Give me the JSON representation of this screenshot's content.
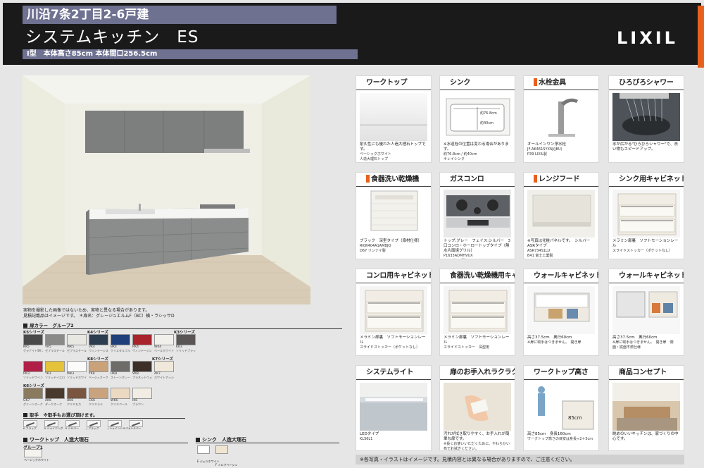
{
  "header": {
    "title": "川沿7条2丁目2-6戸建",
    "product": "システムキッチン　ES",
    "sub": "I型　本体高さ85cm 本体間口256.5cm",
    "logo": "LIXIL"
  },
  "disclaimer": {
    "line1": "実物を撮影した画像ではないため、実物と異なる場合があります。",
    "line2": "見積記載品はイメージです。 ＊扉名：グレージュエルムF（BC）横・ラシッサD"
  },
  "door_color": {
    "title": "扉カラー　グループ2",
    "series": {
      "k5": "K5シリーズ",
      "k4": "K4シリーズ",
      "k3": "K3シリーズ",
      "k8": "K8シリーズ",
      "k7": "K7シリーズ",
      "k6": "K6シリーズ"
    },
    "swatches": [
      {
        "code": "KK5",
        "name": "グラナイトSRブラック",
        "color": "#4a4a4a"
      },
      {
        "code": "VK5",
        "name": "ゼブラスチールシルバー",
        "color": "#8a8a88"
      },
      {
        "code": "WK5",
        "name": "ゼブラスチールホワイト",
        "color": "#e9e7e2"
      },
      {
        "code": "VK4",
        "name": "ヴィンテージストーン",
        "color": "#2b3d4f"
      },
      {
        "code": "BK4",
        "name": "クリスタルブルー",
        "color": "#1f3f7a"
      },
      {
        "code": "RK4",
        "name": "ヴィンテージレッド",
        "color": "#a8232a"
      },
      {
        "code": "WK4",
        "name": "ベールホワイト",
        "color": "#f2f0ea"
      },
      {
        "code": "KK3",
        "name": "ソリッドブラック",
        "color": "#5a5656"
      },
      {
        "code": "RK3",
        "name": "ソリッドワイン",
        "color": "#b21f46"
      },
      {
        "code": "YK3",
        "name": "ソリッドイエロー",
        "color": "#e4c23a"
      },
      {
        "code": "WK3",
        "name": "ソリッドホワイト",
        "color": "#fbfbfa"
      },
      {
        "code": "YK8",
        "name": "ベージュオーク",
        "color": "#c9a27a"
      },
      {
        "code": "UK8",
        "name": "ストーングレー",
        "color": "#6d6c68"
      },
      {
        "code": "VK8",
        "name": "プラネットウォルナット",
        "color": "#3c2f28"
      },
      {
        "code": "AK7",
        "name": "ホワイトアッシュ",
        "color": "#efe8db"
      },
      {
        "code": "GK7",
        "name": "グリーンオーク",
        "color": "#8a7a5e"
      },
      {
        "code": "AK6",
        "name": "ダークオーク",
        "color": "#4a3a2e"
      },
      {
        "code": "UK6",
        "name": "クリエモカ",
        "color": "#7a5540"
      },
      {
        "code": "CK6",
        "name": "クリエラテ",
        "color": "#c9a37d"
      },
      {
        "code": "WK6",
        "name": "クリエペール",
        "color": "#ecd9c1"
      },
      {
        "code": "IK6",
        "name": "ブラウン",
        "color": "#f1ece4"
      }
    ]
  },
  "handles": {
    "title": "取手　※取手もお選び頂けます。",
    "items": [
      "K ブラック",
      "K シャイニング",
      "K シルバー",
      "J ブラック",
      "J シャインシルバー",
      "J シルバー"
    ]
  },
  "worktop": {
    "title": "ワークトップ　人造大理石",
    "group": "グループ1",
    "chip_name": "ベーシックホワイト"
  },
  "sink": {
    "title": "シンク　人造大理石",
    "options": [
      {
        "label": "E",
        "name": "ジェルホワイト",
        "color": "#ffffff"
      },
      {
        "label": "F",
        "name": "ミルクベージュ",
        "color": "#efe5d1"
      }
    ]
  },
  "cards": [
    {
      "title": "ワークトップ",
      "marker": false,
      "desc": "耐久性にも優れた人造大理石トップです。",
      "meta": "ベーシックホワイト",
      "code": "人造大理石トップ"
    },
    {
      "title": "シンク",
      "marker": false,
      "desc": "※水道栓の位置は変わる場合があります。",
      "meta": "約76.8cm / 約40cm",
      "code": "キレイシンク"
    },
    {
      "title": "水栓金具",
      "marker": true,
      "desc": "オールインワン浄水栓",
      "meta": "JF-AK461SYXNJ(JBU)",
      "code": "P39 LIXIL製"
    },
    {
      "title": "ひろびろシャワー",
      "marker": false,
      "desc": "水が広がる\"ひろびろシャワー\"で、洗い物もスピードアップ。",
      "meta": "",
      "code": ""
    },
    {
      "title": "食器洗い乾燥機",
      "marker": true,
      "desc": "ブラック　深型タイプ（扉材仕様）",
      "meta": "RKW404A1AMBJQ",
      "code": "D67 リンナイ製"
    },
    {
      "title": "ガスコンロ",
      "marker": false,
      "desc": "トップ:グレー　フェイス:シルバー　3口コンロ・ホーロートップタイプ（無水片面焼グリル）",
      "meta": "P1633ADMHVUX",
      "code": "Y11 パロマ製"
    },
    {
      "title": "レンジフード",
      "marker": true,
      "desc": "※写真は化粧パネルです。　シルバー　ASRタイプ",
      "meta": "ASR734S1LU",
      "code": "B41 富士工業製"
    },
    {
      "title": "シンク用キャビネット",
      "marker": false,
      "desc": "メラミン扉裏　ソフトモーションレール",
      "meta": "スライドストッカー（ポケットなし）",
      "code": ""
    },
    {
      "title": "コンロ用キャビネット",
      "marker": false,
      "desc": "メラミン扉裏　ソフトモーションレール",
      "meta": "スライドストッカー（ポケットなし）",
      "code": ""
    },
    {
      "title": "食器洗い乾燥機用キャビネット",
      "marker": false,
      "desc": "メラミン扉裏　ソフトモーションレール",
      "meta": "スライドストッカー　深型用",
      "code": ""
    },
    {
      "title": "ウォールキャビネット",
      "marker": false,
      "desc": "高さ37.5cm　奥行60cm",
      "meta": "※扉に取手はつきません。　開き扉",
      "code": ""
    },
    {
      "title": "ウォールキャビネット",
      "marker": false,
      "desc": "高さ37.5cm　奥行60cm",
      "meta": "※扉に取手はつきません。　開き扉　側面・底面不燃仕様",
      "code": ""
    },
    {
      "title": "システムライト",
      "marker": false,
      "desc": "LEDタイプ",
      "meta": "KLS6L1",
      "code": ""
    },
    {
      "title": "扉のお手入れラクラク",
      "marker": false,
      "desc": "汚れが拭き取りやすく、お手入れが簡単な扉です。",
      "meta": "※長くお使いいただくために、やわらかい布でお拭きください。",
      "code": ""
    },
    {
      "title": "ワークトップ高さ",
      "marker": false,
      "desc": "高さ85cm　身長160cm",
      "meta": "ワークトップ高さの目安は身長÷2＋5cm",
      "code": ""
    },
    {
      "title": "商品コンセプト",
      "marker": false,
      "desc": "眺めのいいキッチンは、家づくりの中心です。",
      "meta": "",
      "code": ""
    }
  ],
  "footer": {
    "note": "※各写真・イラストはイメージです。見積内容とは異なる場合がありますので、ご注意ください。"
  },
  "colors": {
    "accent": "#e8601e",
    "header_bg": "#1a1a1a",
    "band": "#6e7190"
  }
}
